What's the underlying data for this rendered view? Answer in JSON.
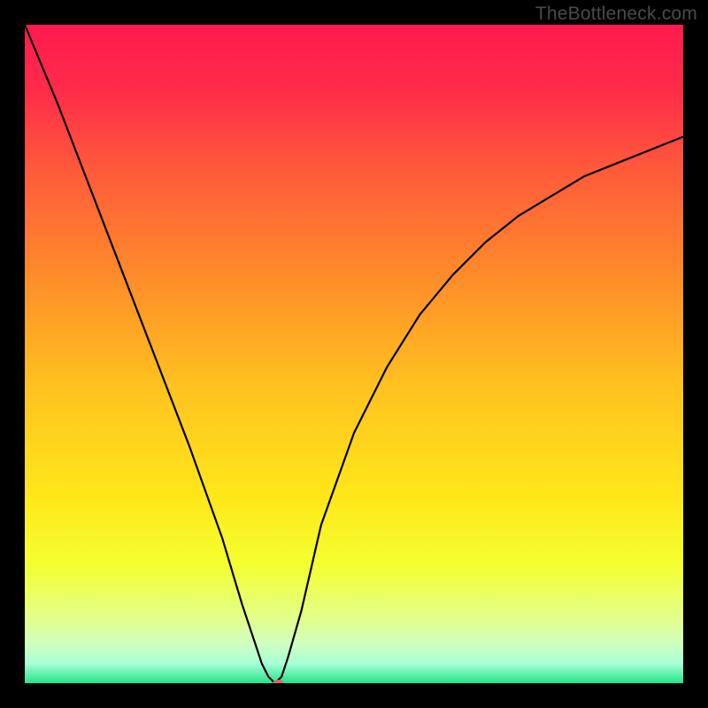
{
  "watermark": "TheBottleneck.com",
  "chart_data": {
    "type": "line",
    "title": "",
    "xlabel": "",
    "ylabel": "",
    "xlim": [
      0,
      100
    ],
    "ylim": [
      0,
      100
    ],
    "grid": false,
    "legend": false,
    "background": {
      "type": "vertical-gradient",
      "stops": [
        {
          "pos": 0.0,
          "color": "#ff1a4f"
        },
        {
          "pos": 0.1,
          "color": "#ff2c49"
        },
        {
          "pos": 0.22,
          "color": "#ff5a3a"
        },
        {
          "pos": 0.38,
          "color": "#ff8b2a"
        },
        {
          "pos": 0.55,
          "color": "#ffc21f"
        },
        {
          "pos": 0.72,
          "color": "#ffe81a"
        },
        {
          "pos": 0.82,
          "color": "#f4ff30"
        },
        {
          "pos": 0.9,
          "color": "#e3ff8a"
        },
        {
          "pos": 0.94,
          "color": "#cfffc0"
        },
        {
          "pos": 0.97,
          "color": "#a8ffd6"
        },
        {
          "pos": 1.0,
          "color": "#23e48a"
        }
      ]
    },
    "series": [
      {
        "name": "curve",
        "color": "#000000",
        "stroke_width": 2.2,
        "x": [
          0,
          5,
          10,
          15,
          20,
          25,
          30,
          33,
          35,
          36,
          37,
          38,
          39,
          40,
          42,
          45,
          50,
          55,
          60,
          65,
          70,
          75,
          80,
          85,
          90,
          95,
          100
        ],
        "values": [
          100,
          88,
          75,
          62,
          49,
          36,
          22,
          12,
          6,
          3,
          1,
          0,
          1,
          4,
          11,
          24,
          38,
          48,
          56,
          62,
          67,
          71,
          74,
          77,
          79,
          81,
          83
        ]
      }
    ],
    "marker": {
      "x": 38.5,
      "y": 0,
      "color": "#d46a6a",
      "rx": 6,
      "ry": 4
    }
  }
}
